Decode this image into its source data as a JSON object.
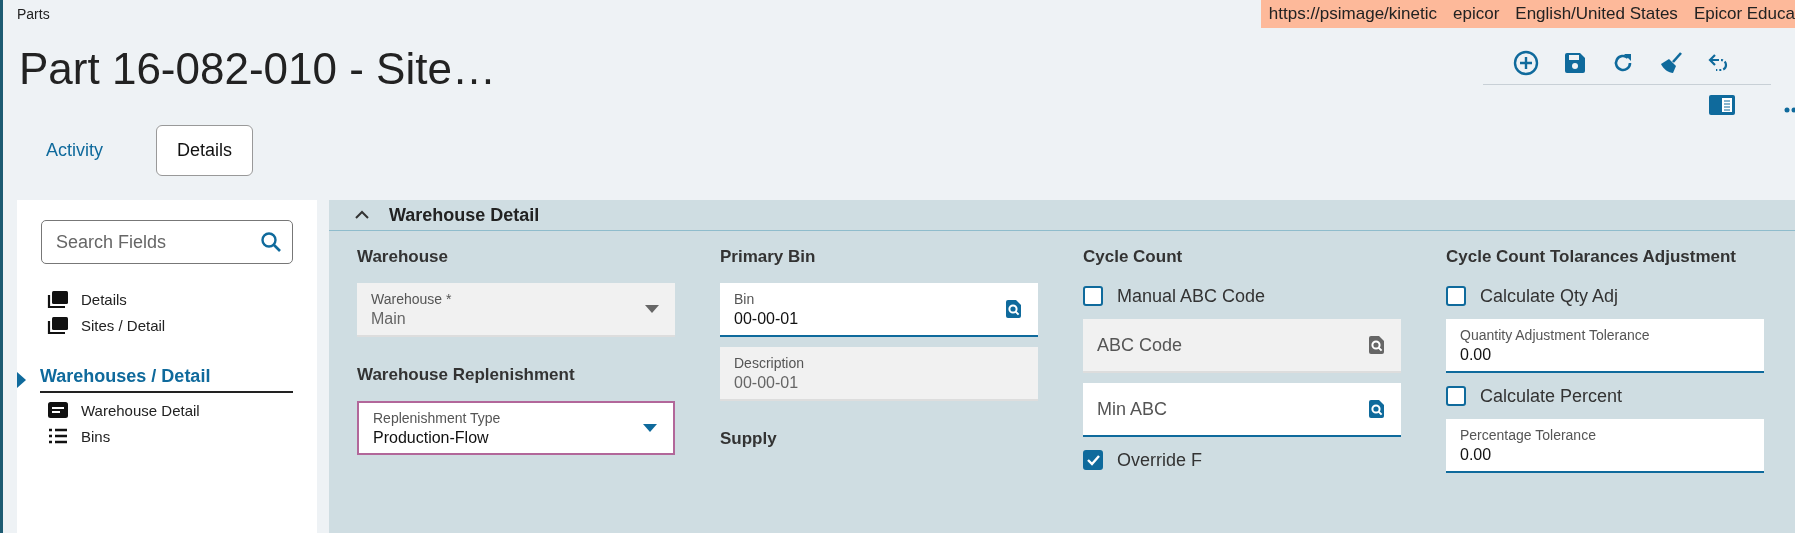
{
  "app_title": "Parts",
  "info_bar": [
    "https://psimage/kinetic",
    "epicor",
    "English/United States",
    "Epicor Educa"
  ],
  "page_title": "Part 16-082-010 - Site…",
  "tabs": [
    {
      "label": "Activity",
      "selected": false
    },
    {
      "label": "Details",
      "selected": true
    }
  ],
  "sidebar": {
    "search": {
      "placeholder": "Search Fields"
    },
    "items": [
      {
        "label": "Details",
        "kind": "page",
        "selected": false
      },
      {
        "label": "Sites / Detail",
        "kind": "page",
        "selected": false
      },
      {
        "label": "Warehouses / Detail",
        "kind": "section",
        "selected": true
      },
      {
        "label": "Warehouse Detail",
        "kind": "card",
        "selected": false
      },
      {
        "label": "Bins",
        "kind": "list",
        "selected": false
      }
    ]
  },
  "panel": {
    "title": "Warehouse Detail",
    "columns": [
      {
        "groups": [
          {
            "heading": "Warehouse",
            "fields": [
              {
                "kind": "select",
                "label": "Warehouse *",
                "value": "Main",
                "disabled": true,
                "focused": false
              }
            ]
          },
          {
            "heading": "Warehouse Replenishment",
            "fields": [
              {
                "kind": "select",
                "label": "Replenishment Type",
                "value": "Production-Flow",
                "disabled": false,
                "focused": true
              }
            ]
          }
        ]
      },
      {
        "groups": [
          {
            "heading": "Primary Bin",
            "fields": [
              {
                "kind": "search",
                "label": "Bin",
                "value": "00-00-01",
                "disabled": false
              },
              {
                "kind": "text",
                "label": "Description",
                "value": "00-00-01",
                "disabled": true
              }
            ]
          },
          {
            "heading": "Supply"
          }
        ]
      },
      {
        "groups": [
          {
            "heading": "Cycle Count",
            "fields": [
              {
                "kind": "checkbox",
                "label": "Manual ABC Code",
                "checked": false
              },
              {
                "kind": "search",
                "placeholder": "ABC Code",
                "disabled": true
              },
              {
                "kind": "search",
                "placeholder": "Min ABC",
                "disabled": false
              },
              {
                "kind": "checkbox",
                "label": "Override F",
                "checked": true
              }
            ]
          }
        ]
      },
      {
        "groups": [
          {
            "heading": "Cycle Count Tolarances Adjustment",
            "fields": [
              {
                "kind": "checkbox",
                "label": "Calculate Qty Adj",
                "checked": false
              },
              {
                "kind": "text",
                "label": "Quantity Adjustment Tolerance",
                "value": "0.00",
                "disabled": false
              },
              {
                "kind": "checkbox",
                "label": "Calculate Percent",
                "checked": false
              },
              {
                "kind": "text",
                "label": "Percentage Tolerance",
                "value": "0.00",
                "disabled": false
              }
            ]
          }
        ]
      }
    ]
  }
}
